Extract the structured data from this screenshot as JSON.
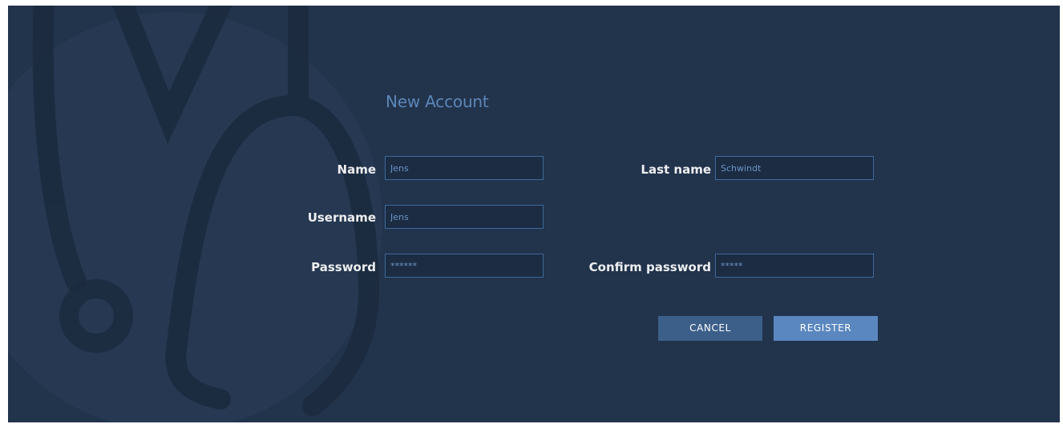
{
  "form": {
    "title": "New Account",
    "name": {
      "label": "Name",
      "value": "Jens"
    },
    "last_name": {
      "label": "Last name",
      "value": "Schwindt"
    },
    "username": {
      "label": "Username",
      "value": "Jens"
    },
    "password": {
      "label": "Password",
      "value": "******"
    },
    "confirm_password": {
      "label": "Confirm password",
      "value": "*****"
    },
    "cancel_label": "CANCEL",
    "register_label": "REGISTER"
  },
  "background": {
    "icon": "stethoscope-icon"
  },
  "colors": {
    "background": "#22334c",
    "title": "#5c86b8",
    "field_border": "#3f6a9c",
    "field_text": "#6d95c6",
    "cancel_button": "#3c5f8a",
    "register_button": "#5a87bf"
  }
}
